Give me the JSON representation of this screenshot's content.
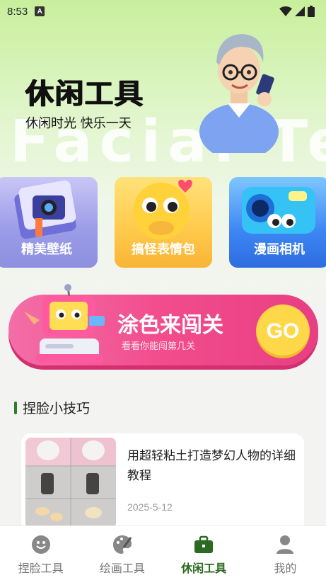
{
  "status_bar": {
    "time": "8:53",
    "app_letter": "A"
  },
  "hero": {
    "title": "休闲工具",
    "subtitle": "休闲时光 快乐一天",
    "watermark": "Facial Tec"
  },
  "feature_cards": [
    {
      "label": "精美壁纸",
      "icon": "book-camera-icon"
    },
    {
      "label": "搞怪表情包",
      "icon": "emoji-face-icon"
    },
    {
      "label": "漫画相机",
      "icon": "cartoon-camera-icon"
    }
  ],
  "banner": {
    "title": "涂色来闯关",
    "subtitle": "看看你能闯第几关",
    "go_label": "GO"
  },
  "section": {
    "title": "捏脸小技巧"
  },
  "article": {
    "title": "用超轻粘土打造梦幻人物的详细教程",
    "date": "2025-5-12"
  },
  "bottom_nav": [
    {
      "label": "捏脸工具",
      "icon": "smiley-icon",
      "active": false
    },
    {
      "label": "绘画工具",
      "icon": "palette-icon",
      "active": false
    },
    {
      "label": "休闲工具",
      "icon": "briefcase-icon",
      "active": true
    },
    {
      "label": "我的",
      "icon": "person-icon",
      "active": false
    }
  ],
  "colors": {
    "accent_green": "#2a6b1f",
    "banner_pink": "#f24c8d",
    "go_yellow": "#ffd84a"
  }
}
